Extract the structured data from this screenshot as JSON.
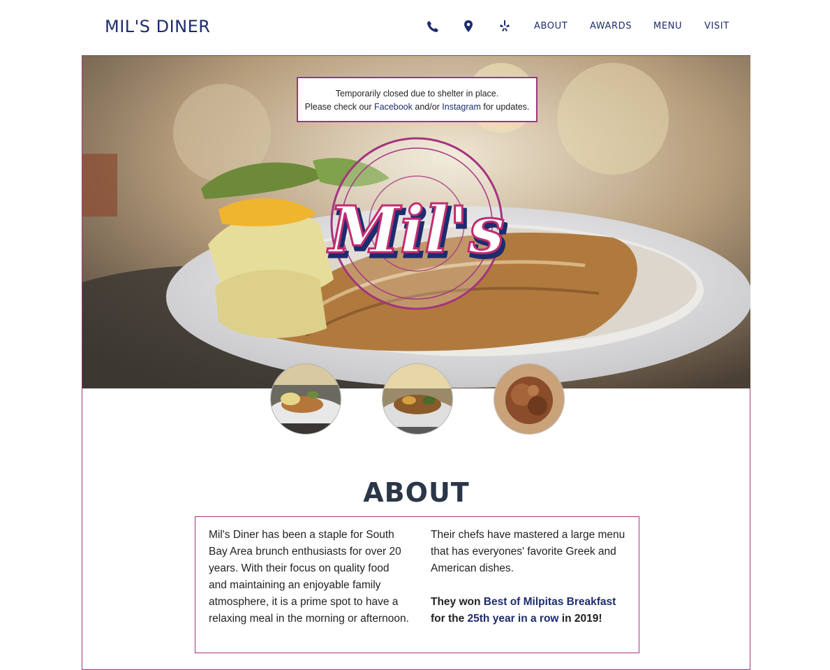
{
  "header": {
    "brand": "MIL'S DINER",
    "icons": [
      "phone-icon",
      "map-pin-icon",
      "yelp-icon"
    ],
    "nav": [
      "ABOUT",
      "AWARDS",
      "MENU",
      "VISIT"
    ]
  },
  "hero": {
    "notice": {
      "line1": "Temporarily closed due to shelter in place.",
      "line2_pre": "Please check our ",
      "facebook": "Facebook",
      "and_or": " and/or ",
      "instagram": "Instagram",
      "line2_post": " for updates."
    },
    "logo_text": "Mil's"
  },
  "about": {
    "title": "ABOUT",
    "col1": "Mil's Diner has been a staple for South Bay Area brunch enthusiasts for over 20 years. With their focus on quality food and maintaining an enjoyable family atmosphere, it is a prime spot to have a relaxing meal in the morning or afternoon.",
    "col2_p1": "Their chefs have mastered a large menu that has everyones' favorite Greek and American dishes.",
    "won_pre": "They won ",
    "won_link1": "Best of Milpitas Breakfast",
    "won_mid": " for the ",
    "won_link2": "25th year in a row",
    "won_post": " in 2019!"
  },
  "colors": {
    "navy": "#1d2c6e",
    "magenta": "#a3347e",
    "heading": "#2b3648"
  }
}
